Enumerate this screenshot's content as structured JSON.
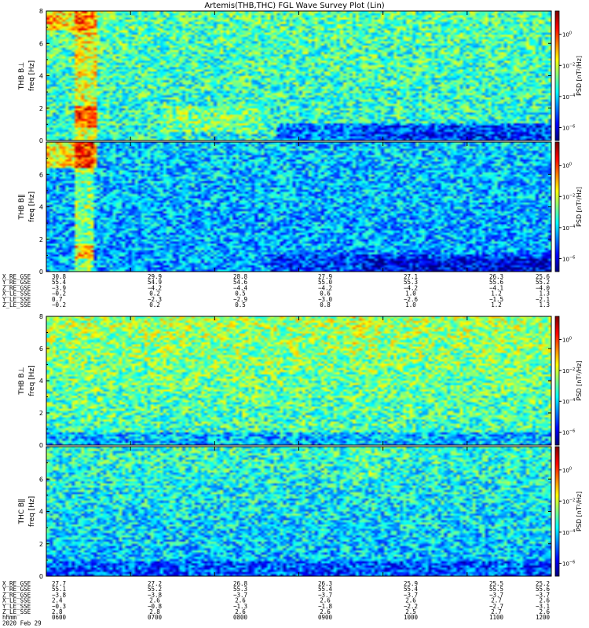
{
  "title": "Artemis(THB,THC) FGL Wave Survey Plot (Lin)",
  "chart_data": [
    {
      "type": "heatmap",
      "id": "p1",
      "ylabel": "THB B⊥",
      "yunit": "freq [Hz]",
      "yticks": [
        "0",
        "2",
        "4",
        "6",
        "8"
      ],
      "ylim": [
        0,
        8
      ],
      "colorbar_label": "PSD [nT²/Hz]",
      "colorbar_ticks": [
        {
          "base": "10",
          "exp": "0"
        },
        {
          "base": "10",
          "exp": "−2"
        },
        {
          "base": "10",
          "exp": "−4"
        },
        {
          "base": "10",
          "exp": "−6"
        }
      ],
      "colorscale": "log"
    },
    {
      "type": "heatmap",
      "id": "p2",
      "ylabel": "THB B∥",
      "yunit": "freq [Hz]",
      "yticks": [
        "0",
        "2",
        "4",
        "6"
      ],
      "ylim": [
        0,
        8
      ],
      "colorbar_label": "PSD [nT²/Hz]",
      "colorbar_ticks": [
        {
          "base": "10",
          "exp": "0"
        },
        {
          "base": "10",
          "exp": "−2"
        },
        {
          "base": "10",
          "exp": "−4"
        },
        {
          "base": "10",
          "exp": "−6"
        }
      ],
      "colorscale": "log"
    },
    {
      "type": "heatmap",
      "id": "p3",
      "ylabel": "THB B⊥",
      "yunit": "freq [Hz]",
      "yticks": [
        "0",
        "2",
        "4",
        "6",
        "8"
      ],
      "ylim": [
        0,
        8
      ],
      "colorbar_label": "PSD [nT²/Hz]",
      "colorbar_ticks": [
        {
          "base": "10",
          "exp": "0"
        },
        {
          "base": "10",
          "exp": "−2"
        },
        {
          "base": "10",
          "exp": "−4"
        },
        {
          "base": "10",
          "exp": "−6"
        }
      ],
      "colorscale": "log"
    },
    {
      "type": "heatmap",
      "id": "p4",
      "ylabel": "THC B∥",
      "yunit": "freq [Hz]",
      "yticks": [
        "0",
        "2",
        "4",
        "6"
      ],
      "ylim": [
        0,
        8
      ],
      "colorbar_label": "PSD [nT²/Hz]",
      "colorbar_ticks": [
        {
          "base": "10",
          "exp": "0"
        },
        {
          "base": "10",
          "exp": "−2"
        },
        {
          "base": "10",
          "exp": "−4"
        },
        {
          "base": "10",
          "exp": "−6"
        }
      ],
      "colorscale": "log"
    }
  ],
  "ephemeris_1": {
    "labels": [
      "X_RE_GSE",
      "Y_RE_GSE",
      "Z_RE_GSE",
      "X_LE_SSE",
      "Y_LE_SSE",
      "Z_LE_SSE"
    ],
    "columns": [
      [
        "30.8",
        "55.4",
        "−3.9",
        "−0.2",
        "0.7",
        "−0.2"
      ],
      [
        "29.9",
        "54.9",
        "−4.2",
        "0.2",
        "−2.3",
        "0.2"
      ],
      [
        "28.8",
        "54.6",
        "−4.4",
        "0.5",
        "−2.9",
        "0.5"
      ],
      [
        "27.9",
        "55.0",
        "−4.2",
        "0.6",
        "−3.0",
        "0.8"
      ],
      [
        "27.1",
        "55.3",
        "−4.2",
        "1.0",
        "−2.6",
        "1.0"
      ],
      [
        "26.3",
        "55.6",
        "−4.1",
        "1.2",
        "−1.5",
        "1.2"
      ],
      [
        "25.6",
        "55.2",
        "−4.0",
        "1.3",
        "−2.1",
        "1.3"
      ]
    ]
  },
  "ephemeris_2": {
    "labels": [
      "X_RE_GSE",
      "Y_RE_GSE",
      "Z_RE_GSE",
      "X_LE_SSE",
      "Y_LE_SSE",
      "Z_LE_SSE",
      "hhmm"
    ],
    "columns": [
      [
        "27.7",
        "55.1",
        "−3.8",
        "2.4",
        "−0.3",
        "2.8",
        "0600"
      ],
      [
        "27.2",
        "55.2",
        "−3.8",
        "2.6",
        "−0.8",
        "2.8",
        "0700"
      ],
      [
        "26.8",
        "55.3",
        "−3.7",
        "2.6",
        "−1.3",
        "2.6",
        "0800"
      ],
      [
        "26.3",
        "55.4",
        "−3.7",
        "2.6",
        "−1.8",
        "2.6",
        "0900"
      ],
      [
        "25.9",
        "55.4",
        "−3.7",
        "2.6",
        "−2.2",
        "2.5",
        "1000"
      ],
      [
        "25.5",
        "55.5",
        "−3.7",
        "2.7",
        "−2.7",
        "2.7",
        "1100"
      ],
      [
        "25.2",
        "55.6",
        "−3.7",
        "2.6",
        "−3.1",
        "2.6",
        "1200"
      ]
    ],
    "date": "2020 Feb 29"
  }
}
